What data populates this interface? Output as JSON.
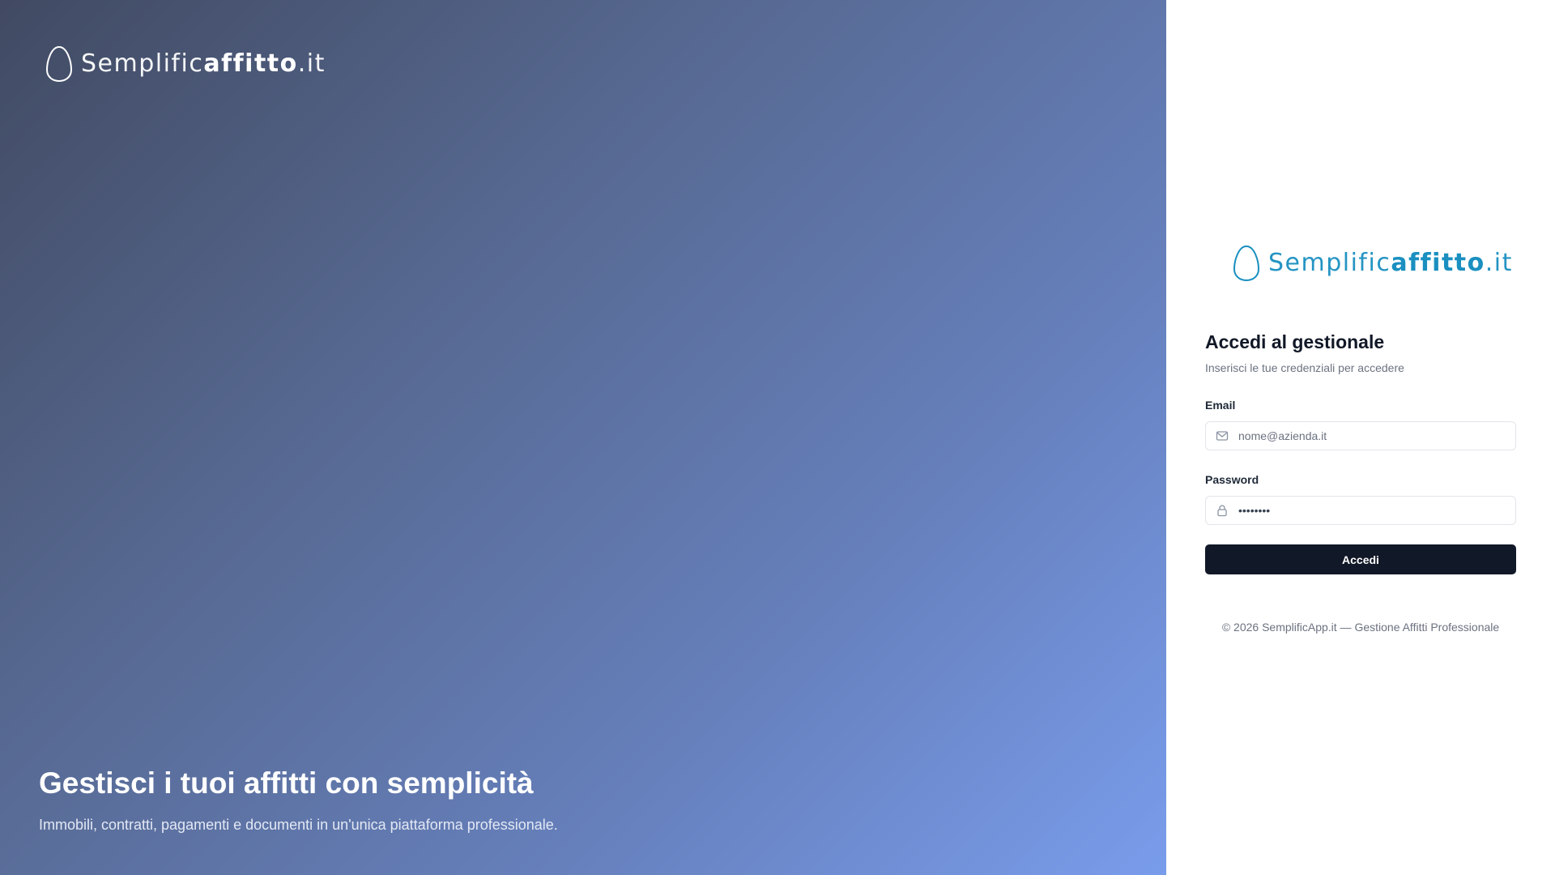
{
  "brand": {
    "name_light": "Semplific",
    "name_bold": "affitto",
    "name_suffix": ".it",
    "logo_icon": "egg-outline-icon",
    "colors": {
      "hero_logo": "#ffffff",
      "panel_logo": "#1a8fc0"
    }
  },
  "hero": {
    "headline": "Gestisci i tuoi affitti con semplicità",
    "subheadline": "Immobili, contratti, pagamenti e documenti in un'unica piattaforma professionale.",
    "gradient": [
      "#414a62",
      "#799ceb"
    ]
  },
  "login": {
    "title": "Accedi al gestionale",
    "subtitle": "Inserisci le tue credenziali per accedere",
    "email": {
      "label": "Email",
      "placeholder": "nome@azienda.it",
      "value": "",
      "icon": "mail-icon"
    },
    "password": {
      "label": "Password",
      "value": "••••••••",
      "icon": "lock-icon"
    },
    "submit_label": "Accedi",
    "button_color": "#111827"
  },
  "footer": {
    "text": "© 2026 SemplificApp.it — Gestione Affitti Professionale"
  }
}
